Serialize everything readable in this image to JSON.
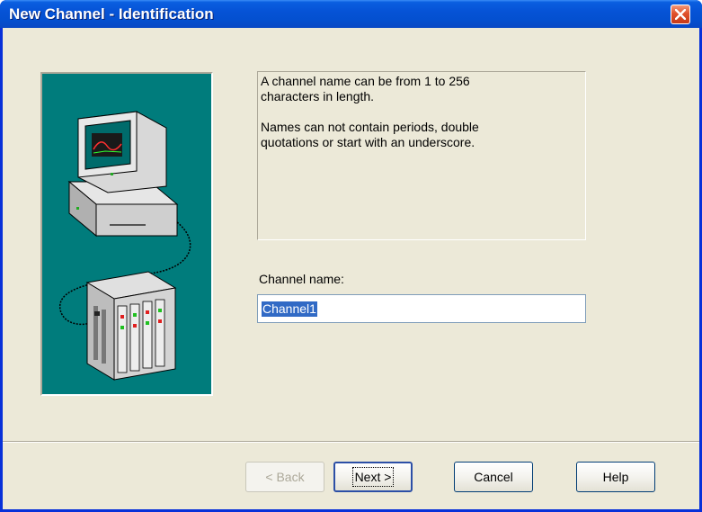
{
  "window": {
    "title": "New Channel - Identification"
  },
  "info": {
    "paragraph1": "A channel name can be from 1 to 256 characters in length.",
    "paragraph2": "Names can not contain periods, double quotations or start with an underscore."
  },
  "channel_name": {
    "label": "Channel name:",
    "value": "Channel1"
  },
  "buttons": {
    "back": "< Back",
    "next": "Next >",
    "cancel": "Cancel",
    "help": "Help"
  },
  "colors": {
    "title_bar": "#0653d6",
    "dialog_face": "#ece9d8",
    "illustration_bg": "#007c7c",
    "selection": "#316ac5",
    "close_button": "#e0512c"
  },
  "icons": [
    "close-icon",
    "computer-network-illustration"
  ]
}
